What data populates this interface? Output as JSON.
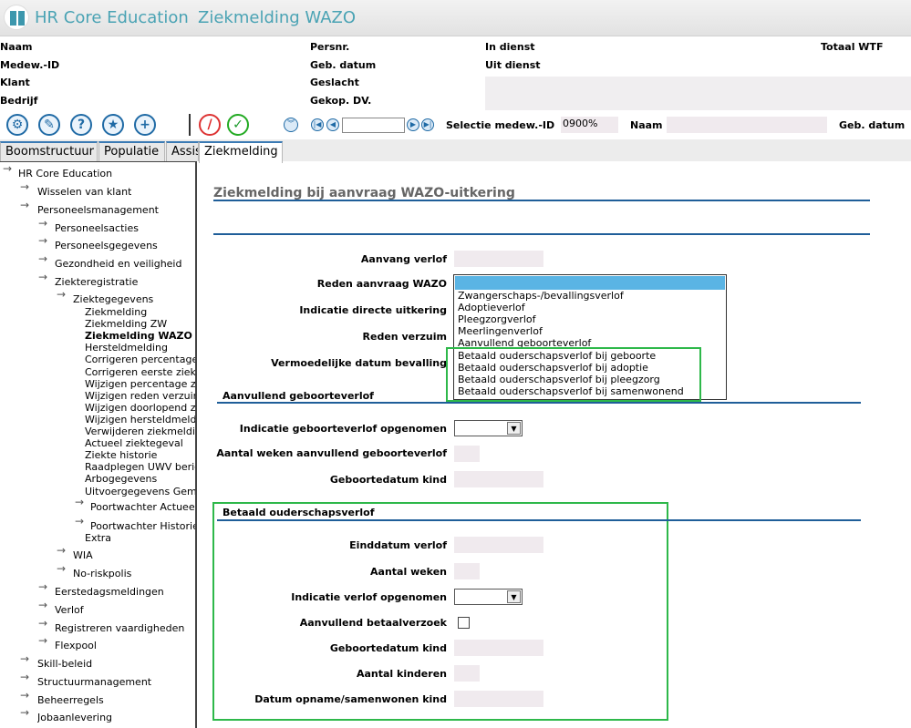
{
  "titlebar": {
    "app": "HR Core Education",
    "page": "Ziekmelding WAZO"
  },
  "header": {
    "naam": "Naam",
    "medew_id": "Medew.-ID",
    "klant": "Klant",
    "bedrijf": "Bedrijf",
    "persnr": "Persnr.",
    "geb_datum": "Geb. datum",
    "geslacht": "Geslacht",
    "gekop_dv": "Gekop. DV.",
    "in_dienst": "In dienst",
    "uit_dienst": "Uit dienst",
    "totaal_wtf": "Totaal WTF"
  },
  "toolbar": {
    "selectie_label": "Selectie medew.-ID",
    "selectie_value": "0900%",
    "naam_label": "Naam",
    "geb_datum_label": "Geb. datum"
  },
  "tabs": [
    "Boomstructuur",
    "Populatie",
    "Assis",
    "Ziekmelding"
  ],
  "tree": {
    "root": "HR Core Education",
    "wisselen": "Wisselen van klant",
    "pm": "Personeelsmanagement",
    "pa": "Personeelsacties",
    "pg": "Personeelsgegevens",
    "gv": "Gezondheid en veiligheid",
    "zr": "Ziekteregistratie",
    "zg": "Ziektegegevens",
    "leaves": [
      "Ziekmelding",
      "Ziekmelding ZW",
      "Ziekmelding WAZO",
      "Hersteldmelding",
      "Corrigeren percentage",
      "Corrigeren eerste ziekt",
      "Wijzigen percentage zi",
      "Wijzigen reden verzuim",
      "Wijzigen doorlopend zi",
      "Wijzigen hersteldmeldi",
      "Verwijderen ziekmeldin",
      "Actueel ziektegeval",
      "Ziekte historie",
      "Raadplegen UWV beric",
      "Arbogegevens",
      "Uitvoergegevens Gema"
    ],
    "pw_actueel": "Poortwachter Actueel",
    "pw_historie": "Poortwachter Historie",
    "extra": "Extra",
    "wia": "WIA",
    "norisk": "No-riskpolis",
    "eerste": "Eerstedagsmeldingen",
    "verlof": "Verlof",
    "registreren": "Registreren vaardigheden",
    "flexpool": "Flexpool",
    "skill": "Skill-beleid",
    "structuur": "Structuurmanagement",
    "beheer": "Beheerregels",
    "job": "Jobaanlevering"
  },
  "form": {
    "title": "Ziekmelding bij aanvraag WAZO-uitkering",
    "aanvang": "Aanvang verlof",
    "reden_wazo": "Reden aanvraag WAZO",
    "indicatie_direct": "Indicatie directe uitkering",
    "reden_verzuim": "Reden verzuim",
    "vermoed": "Vermoedelijke datum bevalling",
    "sec1": "Aanvullend geboorteverlof",
    "ind_geb": "Indicatie geboorteverlof opgenomen",
    "weken_geb": "Aantal weken aanvullend geboorteverlof",
    "gebdatum1": "Geboortedatum kind",
    "sec2": "Betaald ouderschapsverlof",
    "einddatum": "Einddatum verlof",
    "aantal_weken": "Aantal weken",
    "ind_verlof": "Indicatie verlof opgenomen",
    "aanv_betaal": "Aanvullend betaalverzoek",
    "gebdatum2": "Geboortedatum kind",
    "aantal_kinderen": "Aantal kinderen",
    "datum_opname": "Datum opname/samenwonen kind",
    "dropdown_options": [
      "Zwangerschaps-/bevallingsverlof",
      "Adoptieverlof",
      "Pleegzorgverlof",
      "Meerlingenverlof",
      "Aanvullend geboorteverlof",
      "Betaald ouderschapsverlof bij geboorte",
      "Betaald ouderschapsverlof bij adoptie",
      "Betaald ouderschapsverlof bij pleegzorg",
      "Betaald ouderschapsverlof bij samenwonend"
    ]
  },
  "colors": {
    "accent": "#1f5e99",
    "highlight": "#5ab4e4",
    "annotation": "#2eb84a"
  }
}
